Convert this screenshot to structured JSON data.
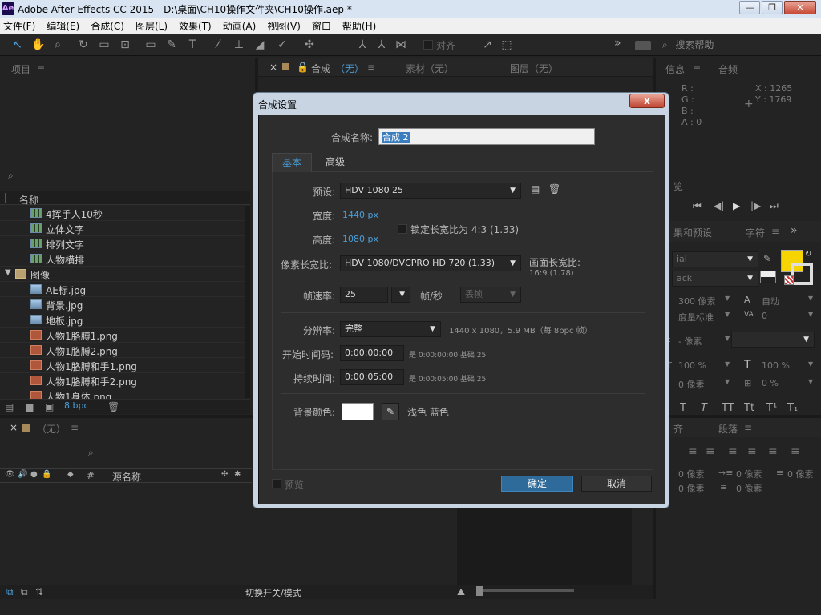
{
  "window": {
    "title": "Adobe After Effects CC 2015 - D:\\桌面\\CH10操作文件夹\\CH10操作.aep *",
    "app_logo": "Ae",
    "minimize": "—",
    "restore": "❐",
    "close": "✕"
  },
  "menu": [
    "文件(F)",
    "编辑(E)",
    "合成(C)",
    "图层(L)",
    "效果(T)",
    "动画(A)",
    "视图(V)",
    "窗口",
    "帮助(H)"
  ],
  "toolbar": {
    "align_label": "对齐",
    "more": "»",
    "search_placeholder": "搜索帮助"
  },
  "project_panel": {
    "tab": "项目",
    "search_icon": "⌕",
    "column_name": "名称",
    "items": [
      {
        "name": "4挥手人10秒",
        "type": "comp"
      },
      {
        "name": "立体文字",
        "type": "comp"
      },
      {
        "name": "排列文字",
        "type": "comp"
      },
      {
        "name": "人物横排",
        "type": "comp"
      },
      {
        "name": "图像",
        "type": "folder"
      },
      {
        "name": "AE标.jpg",
        "type": "img"
      },
      {
        "name": "背景.jpg",
        "type": "img"
      },
      {
        "name": "地板.jpg",
        "type": "img"
      },
      {
        "name": "人物1胳膊1.png",
        "type": "png"
      },
      {
        "name": "人物1胳膊2.png",
        "type": "png"
      },
      {
        "name": "人物1胳膊和手1.png",
        "type": "png"
      },
      {
        "name": "人物1胳膊和手2.png",
        "type": "png"
      },
      {
        "name": "人物1身体.png",
        "type": "png"
      }
    ],
    "bpc": "8 bpc"
  },
  "viewer_tabs": {
    "comp": "合成",
    "comp_value": "（无）",
    "footage": "素材（无）",
    "layer": "图层（无）"
  },
  "info_panel": {
    "tab_info": "信息",
    "tab_audio": "音频",
    "r": "R :",
    "g": "G :",
    "b": "B :",
    "a": "A : 0",
    "x": "X : 1265",
    "y": "Y : 1769"
  },
  "preview_panel": {
    "tab": "览"
  },
  "char_panel": {
    "tab_effects": "果和预设",
    "tab_char": "字符",
    "font": "ial",
    "style": "ack",
    "size": "300 像素",
    "leading": "自动",
    "kerning": "度量标准",
    "tracking": "0",
    "stroke": "- 像素",
    "vscale": "100 %",
    "hscale": "100 %",
    "baseline": "0 像素",
    "tsume": "0 %",
    "styles": [
      "T",
      "T",
      "TT",
      "Tt",
      "T¹",
      "T₁"
    ]
  },
  "paragraph_panel": {
    "tab_align": "齐",
    "tab_para": "段落",
    "indent": [
      "0 像素",
      "0 像素",
      "0 像素",
      "0 像素",
      "0 像素"
    ]
  },
  "timeline": {
    "tab": "（无）",
    "col_source": "源名称",
    "bottom_toggle": "切换开关/模式"
  },
  "dialog": {
    "title": "合成设置",
    "close": "x",
    "name_label": "合成名称:",
    "name_value": "合成 2",
    "tabs": [
      "基本",
      "高级"
    ],
    "preset_label": "预设:",
    "preset_value": "HDV 1080 25",
    "width_label": "宽度:",
    "width_value": "1440 px",
    "lock_label": "锁定长宽比为 4:3 (1.33)",
    "height_label": "高度:",
    "height_value": "1080 px",
    "par_label": "像素长宽比:",
    "par_value": "HDV 1080/DVCPRO HD 720 (1.33)",
    "frame_ar_label": "画面长宽比:",
    "frame_ar_value": "16:9 (1.78)",
    "fps_label": "帧速率:",
    "fps_value": "25",
    "fps_unit": "帧/秒",
    "drop_frame": "丢帧",
    "res_label": "分辨率:",
    "res_value": "完整",
    "res_info": "1440 x 1080，5.9 MB（每 8bpc 帧）",
    "start_label": "开始时间码:",
    "start_value": "0:00:00:00",
    "start_info": "是 0:00:00:00  基础 25",
    "dur_label": "持续时间:",
    "dur_value": "0:00:05:00",
    "dur_info": "是 0:00:05:00  基础 25",
    "bg_label": "背景颜色:",
    "bg_color_name": "浅色 蓝色",
    "bg_color": "#ffffff",
    "preview_label": "预览",
    "ok": "确定",
    "cancel": "取消"
  },
  "colors": {
    "accent": "#4a9ed8",
    "fill_swatch": "#f5d400",
    "ok_button": "#2e6a9a"
  }
}
